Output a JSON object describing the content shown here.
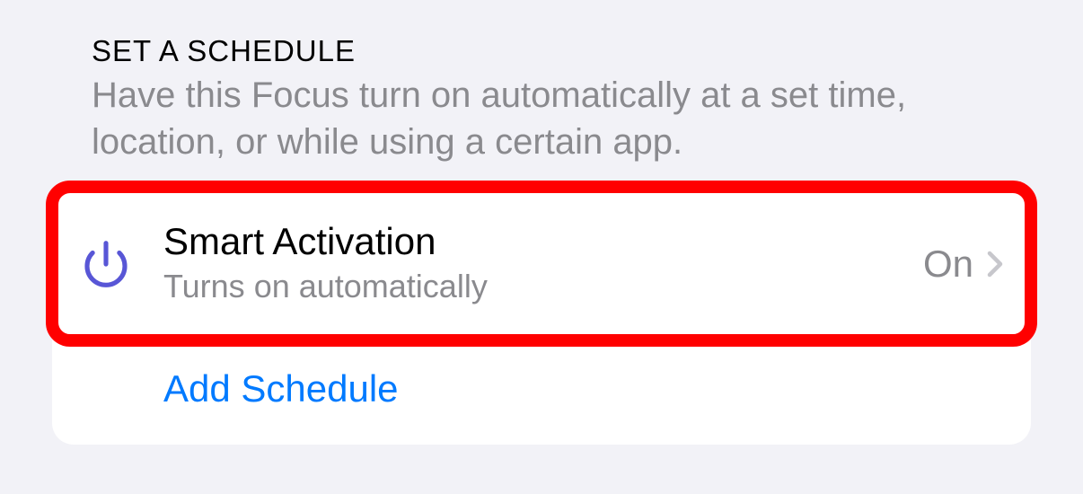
{
  "section": {
    "title": "SET A SCHEDULE",
    "description": "Have this Focus turn on automatically at a set time, location, or while using a certain app."
  },
  "rows": {
    "smartActivation": {
      "title": "Smart Activation",
      "subtitle": "Turns on automatically",
      "value": "On",
      "iconName": "power-icon"
    },
    "addSchedule": {
      "label": "Add Schedule"
    }
  },
  "colors": {
    "iconPurple": "#5856d6",
    "accentBlue": "#007aff",
    "highlightRed": "#ff0000"
  }
}
